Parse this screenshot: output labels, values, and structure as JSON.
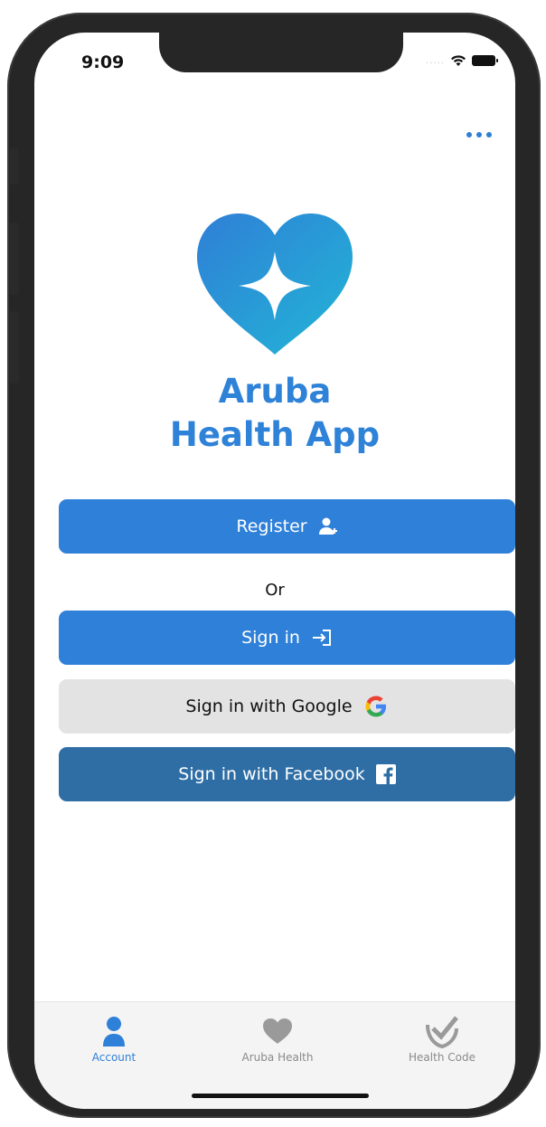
{
  "status_bar": {
    "time": "9:09",
    "signal": "....."
  },
  "header": {
    "menu_icon": "more-horizontal-icon"
  },
  "app": {
    "title_line1": "Aruba",
    "title_line2": "Health App",
    "logo_icon": "heart-star-logo"
  },
  "actions": {
    "register_label": "Register",
    "register_icon": "add-user-icon",
    "or_label": "Or",
    "signin_label": "Sign in",
    "signin_icon": "sign-in-arrow-icon",
    "google_label": "Sign in with Google",
    "google_icon": "google-g-icon",
    "facebook_label": "Sign in with Facebook",
    "facebook_icon": "facebook-f-icon"
  },
  "tabbar": {
    "active_tab": "Account",
    "tabs": [
      {
        "label": "Account",
        "icon": "user-icon",
        "color": "#2f80d8"
      },
      {
        "label": "Aruba Health",
        "icon": "heart-icon",
        "color": "#9a9a9a"
      },
      {
        "label": "Health Code",
        "icon": "check-shield-icon",
        "color": "#9a9a9a"
      }
    ]
  },
  "colors": {
    "primary": "#2f80d8",
    "facebook": "#2f6ea5",
    "google_button": "#e3e3e3",
    "title": "#2e82d8"
  }
}
